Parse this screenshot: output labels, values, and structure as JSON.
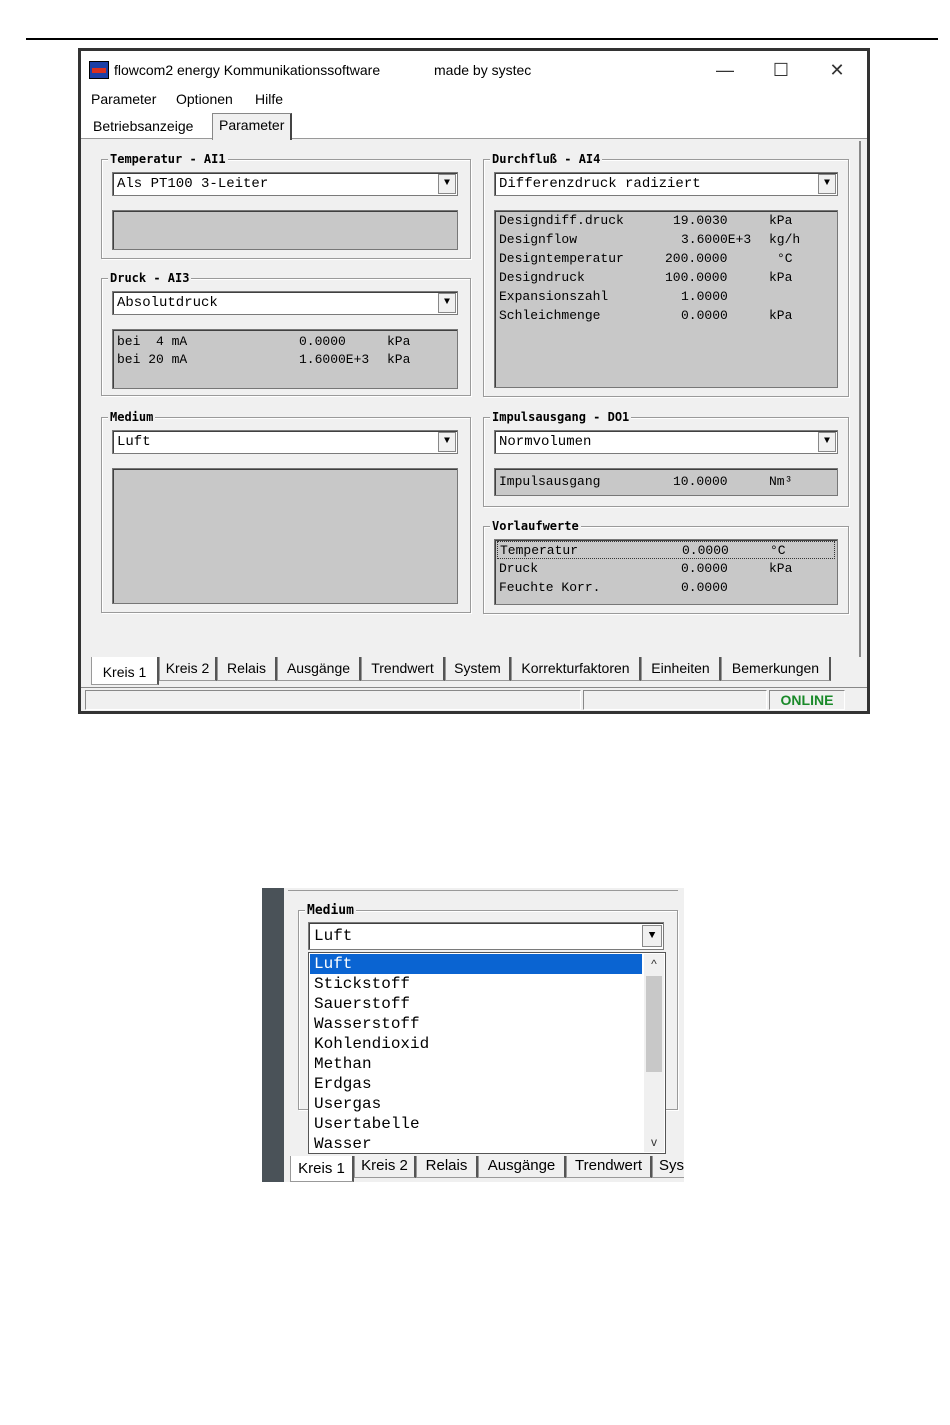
{
  "window": {
    "title": "flowcom2 energy Kommunikationssoftware",
    "made_by": "made by systec",
    "minimize": "—",
    "maximize": "☐",
    "close": "✕"
  },
  "menu": [
    "Parameter",
    "Optionen",
    "Hilfe"
  ],
  "top_tabs": [
    "Betriebsanzeige",
    "Parameter"
  ],
  "groups": {
    "temperatur": {
      "title": "Temperatur - AI1",
      "selected": "Als PT100 3-Leiter"
    },
    "druck": {
      "title": "Druck - AI3",
      "selected": "Absolutdruck",
      "rows": [
        {
          "label": "bei  4 mA",
          "value": "0.0000",
          "unit": "kPa"
        },
        {
          "label": "bei 20 mA",
          "value": "1.6000E+3",
          "unit": "kPa"
        }
      ]
    },
    "medium": {
      "title": "Medium",
      "selected": "Luft"
    },
    "durchfluss": {
      "title": "Durchfluß - AI4",
      "selected": "Differenzdruck radiziert",
      "rows": [
        {
          "label": "Designdiff.druck",
          "value": "19.0030",
          "unit": "kPa"
        },
        {
          "label": "Designflow",
          "value": "3.6000E+3",
          "unit": "kg/h"
        },
        {
          "label": "Designtemperatur",
          "value": "200.0000",
          "unit": "°C"
        },
        {
          "label": "Designdruck",
          "value": "100.0000",
          "unit": "kPa"
        },
        {
          "label": "Expansionszahl",
          "value": "1.0000",
          "unit": ""
        },
        {
          "label": "Schleichmenge",
          "value": "0.0000",
          "unit": "kPa"
        }
      ]
    },
    "impuls": {
      "title": "Impulsausgang - DO1",
      "selected": "Normvolumen",
      "rows": [
        {
          "label": "Impulsausgang",
          "value": "10.0000",
          "unit": "Nm³"
        }
      ]
    },
    "vorlauf": {
      "title": "Vorlaufwerte",
      "rows": [
        {
          "label": "Temperatur",
          "value": "0.0000",
          "unit": "°C"
        },
        {
          "label": "Druck",
          "value": "0.0000",
          "unit": "kPa"
        },
        {
          "label": "Feuchte Korr.",
          "value": "0.0000",
          "unit": ""
        }
      ]
    }
  },
  "bottom_tabs": [
    "Kreis 1",
    "Kreis 2",
    "Relais",
    "Ausgänge",
    "Trendwert",
    "System",
    "Korrekturfaktoren",
    "Einheiten",
    "Bemerkungen"
  ],
  "status": {
    "online": "ONLINE"
  },
  "dropdown_shot": {
    "group_title": "Medium",
    "selected": "Luft",
    "options": [
      "Luft",
      "Stickstoff",
      "Sauerstoff",
      "Wasserstoff",
      "Kohlendioxid",
      "Methan",
      "Erdgas",
      "Usergas",
      "Usertabelle",
      "Wasser"
    ],
    "tabs": [
      "Kreis 1",
      "Kreis 2",
      "Relais",
      "Ausgänge",
      "Trendwert",
      "Sys"
    ],
    "arrow_up": "^",
    "arrow_down": "v"
  },
  "icons": {
    "combo_arrow": "▼"
  }
}
